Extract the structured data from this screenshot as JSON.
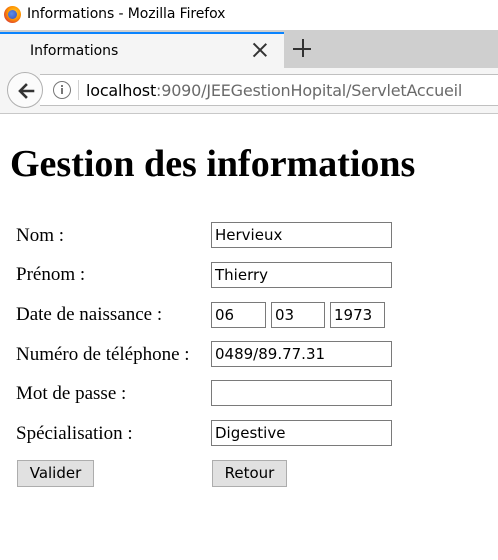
{
  "window": {
    "title": "Informations - Mozilla Firefox"
  },
  "tab": {
    "label": "Informations"
  },
  "url": {
    "host": "localhost",
    "path": ":9090/JEEGestionHopital/ServletAccueil"
  },
  "page": {
    "title": "Gestion des informations"
  },
  "form": {
    "nom": {
      "label": "Nom :",
      "value": "Hervieux"
    },
    "prenom": {
      "label": "Prénom :",
      "value": "Thierry"
    },
    "date_naissance": {
      "label": "Date de naissance :",
      "day": "06",
      "month": "03",
      "year": "1973"
    },
    "telephone": {
      "label": "Numéro de téléphone :",
      "value": "0489/89.77.31"
    },
    "mot_de_passe": {
      "label": "Mot de passe :",
      "value": ""
    },
    "specialisation": {
      "label": "Spécialisation :",
      "value": "Digestive"
    }
  },
  "buttons": {
    "valider": "Valider",
    "retour": "Retour"
  }
}
